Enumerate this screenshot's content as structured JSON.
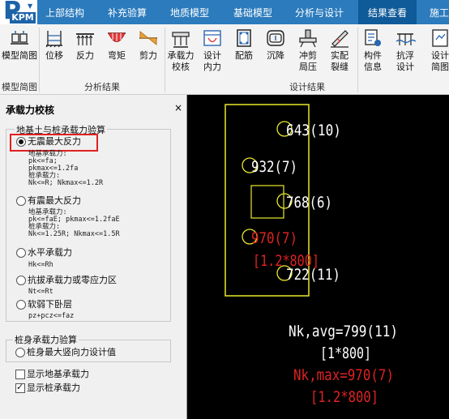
{
  "app": {
    "logo_text": "P",
    "logo_sub": "KPM",
    "menu_tabs": [
      "上部结构",
      "补充验算",
      "地质模型",
      "基础模型",
      "分析与设计",
      "结果查看",
      "施工"
    ]
  },
  "ribbon": {
    "buttons": [
      {
        "label": "模型简图",
        "icon": "model-sketch-icon"
      },
      {
        "label": "位移",
        "icon": "displacement-icon"
      },
      {
        "label": "反力",
        "icon": "reaction-icon"
      },
      {
        "label": "弯矩",
        "icon": "moment-icon"
      },
      {
        "label": "剪力",
        "icon": "shear-icon"
      },
      {
        "label": "承载力\n校核",
        "icon": "bearing-check-icon"
      },
      {
        "label": "设计\n内力",
        "icon": "design-force-icon"
      },
      {
        "label": "配筋",
        "icon": "reinforcement-icon"
      },
      {
        "label": "沉降",
        "icon": "settlement-icon"
      },
      {
        "label": "冲剪\n局压",
        "icon": "punching-icon"
      },
      {
        "label": "实配\n裂缝",
        "icon": "crack-icon"
      },
      {
        "label": "构件\n信息",
        "icon": "member-info-icon"
      },
      {
        "label": "抗浮\n设计",
        "icon": "anti-float-icon"
      },
      {
        "label": "设计\n简图",
        "icon": "design-sketch-icon"
      }
    ],
    "groups": [
      "模型简图",
      "分析结果",
      "设计结果"
    ]
  },
  "panel": {
    "title": "承载力校核",
    "close": "×",
    "group1_title": "地基土与桩承载力验算",
    "options": [
      {
        "label": "无震最大反力",
        "checked": true,
        "formula": [
          "地基承载力:",
          "pk<=fa;",
          "pkmax<=1.2fa",
          "桩承载力:",
          "Nk<=R; Nkmax<=1.2R"
        ]
      },
      {
        "label": "有震最大反力",
        "checked": false,
        "formula": [
          "地基承载力:",
          "pk<=faE; pkmax<=1.2faE",
          "桩承载力:",
          "Nk<=1.25R; Nkmax<=1.5R"
        ]
      },
      {
        "label": "水平承载力",
        "checked": false,
        "formula": [
          "Hk<=Rh"
        ]
      },
      {
        "label": "抗拔承载力或零应力区",
        "checked": false,
        "formula": [
          "Nt<=Rt"
        ]
      },
      {
        "label": "软弱下卧层",
        "checked": false,
        "formula": [
          "pz+pcz<=faz"
        ]
      }
    ],
    "group2_title": "桩身承载力验算",
    "pile_option": "桩身最大竖向力设计值",
    "checkboxes": [
      {
        "label": "显示地基承载力",
        "checked": false
      },
      {
        "label": "显示桩承载力",
        "checked": true
      }
    ]
  },
  "canvas": {
    "piles": [
      {
        "value": "643(10)",
        "color": "#ffffff"
      },
      {
        "value": "932(7)",
        "color": "#ffffff"
      },
      {
        "value": "768(6)",
        "color": "#ffffff"
      },
      {
        "value": "970(7)",
        "color": "#dd2222"
      },
      {
        "value": "722(11)",
        "color": "#ffffff"
      }
    ],
    "pile_note": "[1.2*800]",
    "summary": [
      "Nk,avg=799(11)",
      "[1*800]",
      "Nk,max=970(7)",
      "[1.2*800]"
    ],
    "colors": {
      "outline": "#e8e82a",
      "text": "#ffffff",
      "warn": "#dd2222",
      "background": "#000000"
    }
  }
}
